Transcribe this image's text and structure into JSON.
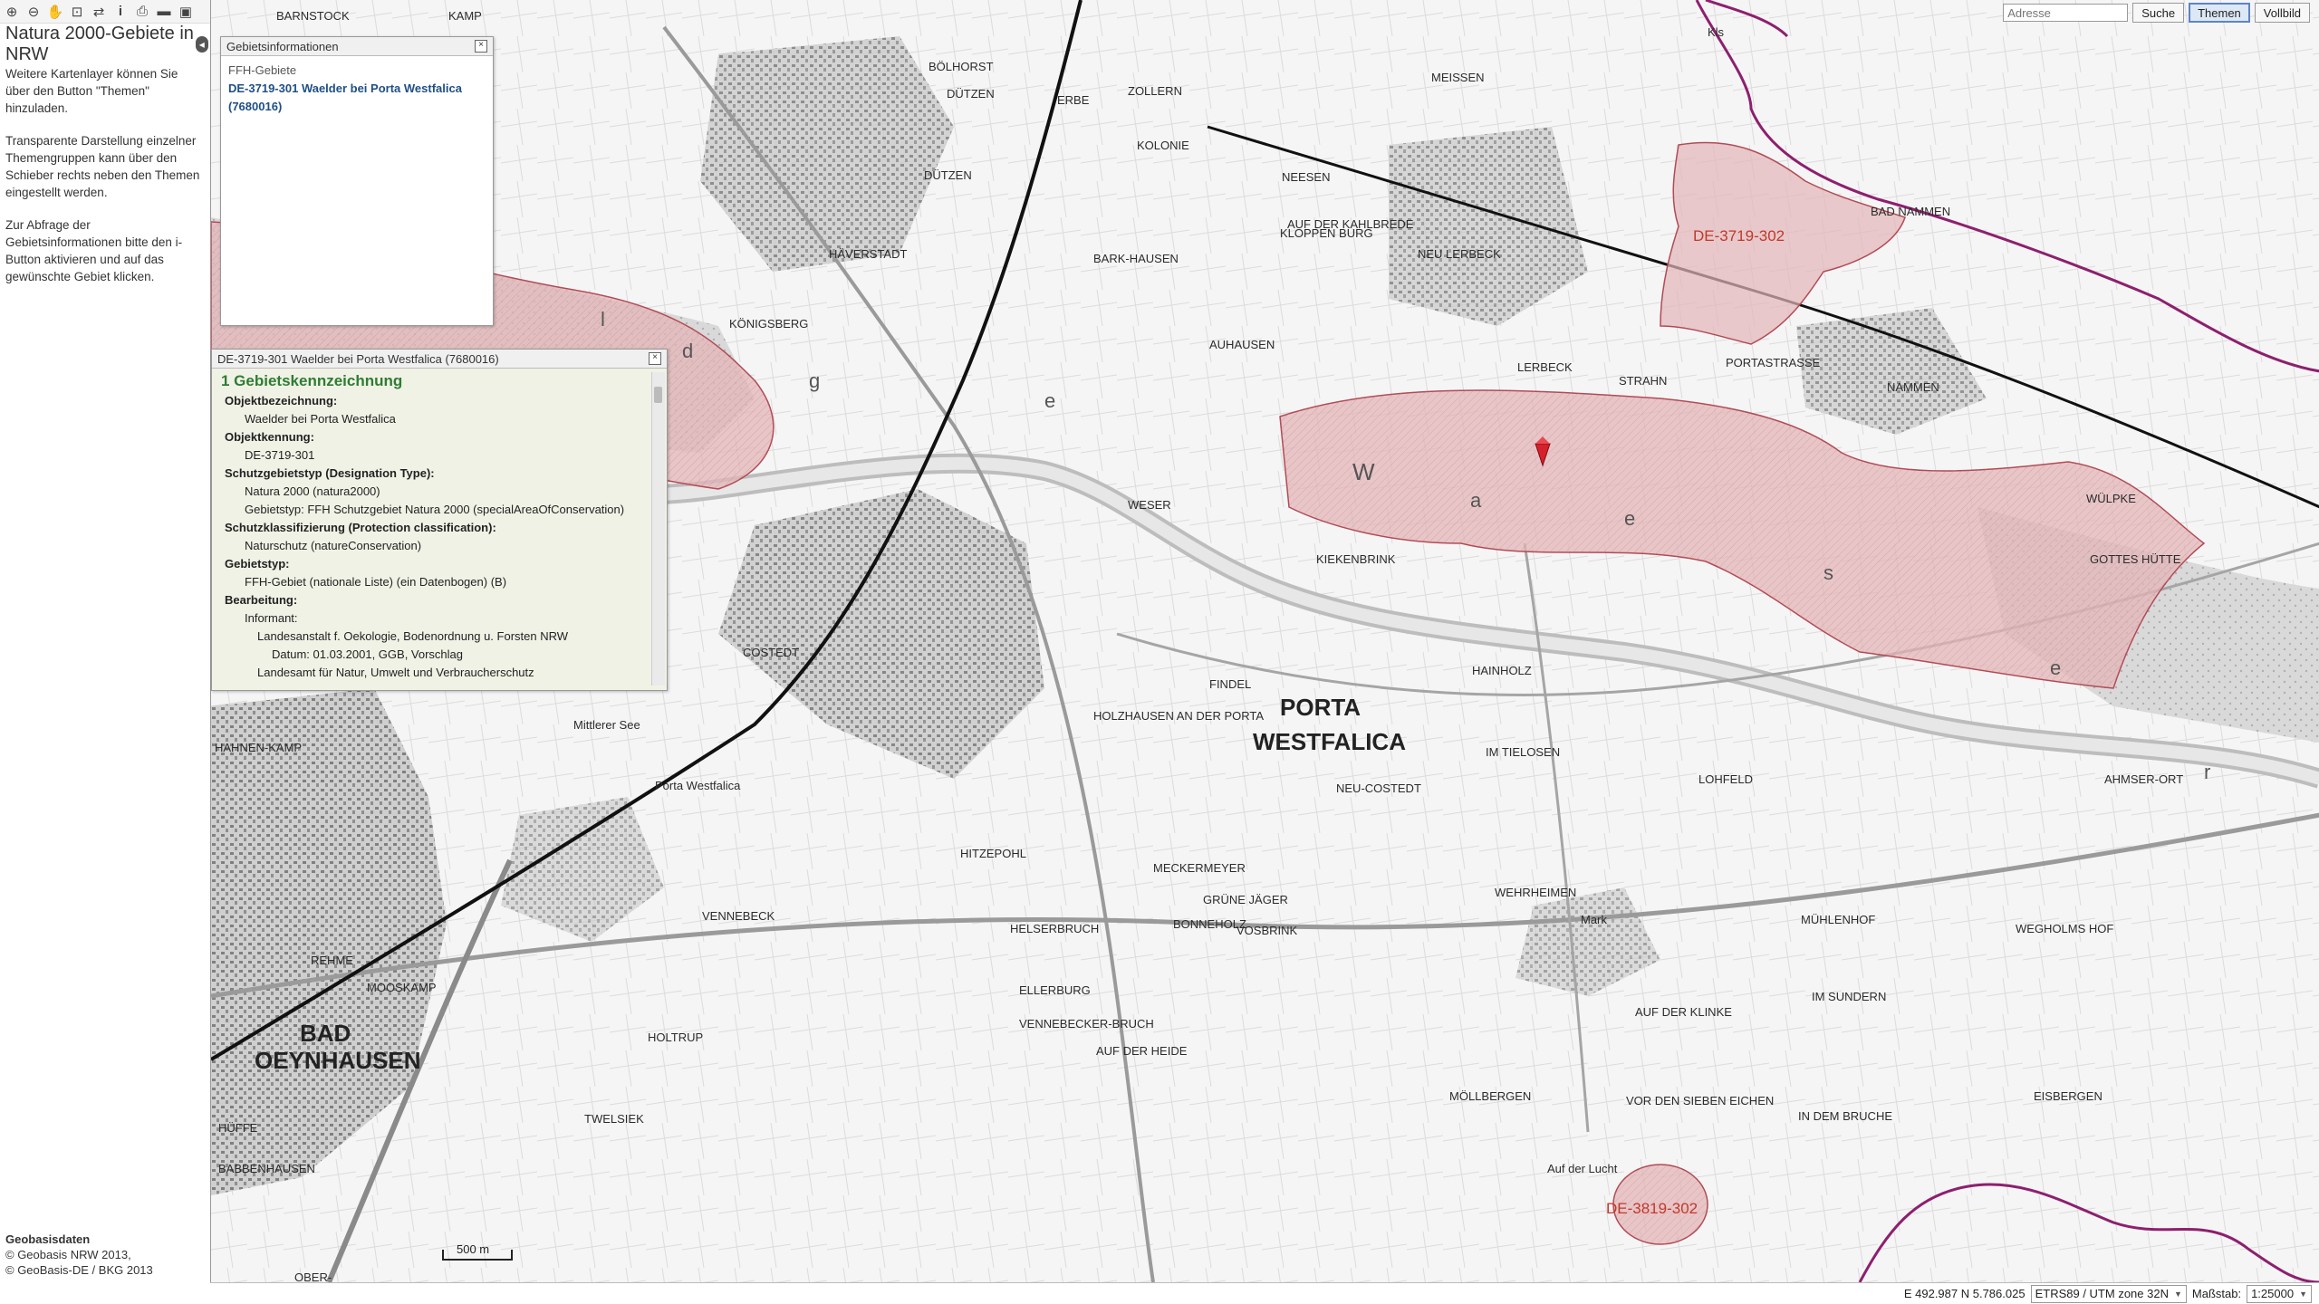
{
  "toolbar": {
    "icons": [
      "zoom-in-icon",
      "zoom-out-icon",
      "pan-icon",
      "zoom-box-icon",
      "back-icon",
      "info-icon",
      "print-icon",
      "measure-icon",
      "fullextent-icon"
    ]
  },
  "sidebar": {
    "title": "Natura 2000-Gebiete in NRW",
    "paragraphs": [
      "Weitere Kartenlayer können Sie über den Button \"Themen\" hinzuladen.",
      "Transparente Darstellung einzelner Themengruppen kann über den Schieber rechts neben den Themen eingestellt werden.",
      "Zur Abfrage der Gebietsinformationen bitte den i-Button aktivieren und auf das gewünschte Gebiet klicken."
    ],
    "footer": {
      "heading": "Geobasisdaten",
      "lines": [
        "© Geobasis NRW 2013,",
        "© GeoBasis-DE / BKG 2013"
      ]
    }
  },
  "topbar": {
    "address_placeholder": "Adresse",
    "search_label": "Suche",
    "themes_label": "Themen",
    "fullscreen_label": "Vollbild"
  },
  "info_panel": {
    "title": "Gebietsinformationen",
    "category": "FFH-Gebiete",
    "link_text": "DE-3719-301 Waelder bei Porta Westfalica (7680016)"
  },
  "detail_panel": {
    "title": "DE-3719-301 Waelder bei Porta Westfalica (7680016)",
    "section": "1 Gebietskennzeichnung",
    "fields": [
      {
        "label": "Objektbezeichnung:",
        "values": [
          "Waelder bei Porta Westfalica"
        ]
      },
      {
        "label": "Objektkennung:",
        "values": [
          "DE-3719-301"
        ]
      },
      {
        "label": "Schutzgebietstyp (Designation Type):",
        "values": [
          "Natura 2000 (natura2000)",
          "Gebietstyp: FFH Schutzgebiet Natura 2000 (specialAreaOfConservation)"
        ]
      },
      {
        "label": "Schutzklassifizierung (Protection classification):",
        "values": [
          "Naturschutz (natureConservation)"
        ]
      },
      {
        "label": "Gebietstyp:",
        "values": [
          "FFH-Gebiet (nationale Liste) (ein Datenbogen) (B)"
        ]
      },
      {
        "label": "Bearbeitung:",
        "values": []
      }
    ],
    "bearbeitung": {
      "informant_label": "Informant:",
      "line1": "Landesanstalt f. Oekologie, Bodenordnung u. Forsten NRW",
      "line2": "Datum: 01.03.2001, GGB, Vorschlag",
      "line3": "Landesamt für Natur, Umwelt und Verbraucherschutz"
    }
  },
  "map": {
    "labels": {
      "ffh_area_a": "DE-3719-302",
      "ffh_area_b": "DE-3819-302",
      "city_porta_1": "PORTA",
      "city_porta_2": "WESTFALICA",
      "city_bad_1": "BAD",
      "city_bad_2": "OEYNHAUSEN",
      "forest_w": "W",
      "forest_a": "a",
      "forest_l": "l",
      "forest_d": "d",
      "forest_e": "e",
      "forest_r": "r",
      "forest_g": "g",
      "forest_e2": "e",
      "forest_s": "s",
      "forest_e3": "e",
      "place_list": [
        "BARNSTOCK",
        "KAMP",
        "BÖLHORST",
        "DÜTZEN",
        "ERBE",
        "ZOLLERN",
        "KOLONIE",
        "HÄVERSTADT",
        "BARK-HAUSEN",
        "KÖNIGSBERG",
        "AUHAUSEN",
        "NEESEN",
        "KLOPPEN BURG",
        "AUF DER KAHLBREDE",
        "NEU LERBECK",
        "MEISSEN",
        "LERBECK",
        "STRAHN",
        "NAMMEN",
        "BAD NAMMEN",
        "PORTASTRASSE",
        "COSTEDT",
        "KIEKENBRINK",
        "HAINHOLZ",
        "LOHFELD",
        "IM TIELOSEN",
        "NEU-COSTEDT",
        "FINDEL",
        "HOLZHAUSEN AN DER PORTA",
        "HAHNEN-KAMP",
        "REHME",
        "MOOSKAMP",
        "HITZEPOHL",
        "VENNEBECK",
        "HELSERBRUCH",
        "BONNEHOLZ",
        "VOSBRINK",
        "ELLERBURG",
        "VENNEBECKER-BRUCH",
        "AUF DER HEIDE",
        "HOLTRUP",
        "MÖLLBERGEN",
        "AUF DER KLINKE",
        "VOR DEN SIEBEN EICHEN",
        "IN DEM BRUCHE",
        "EISBERGEN",
        "IM SUNDERN",
        "AHMSER-ORT",
        "WÜLPKE",
        "GOTTES HÜTTE",
        "BABBENHAUSEN",
        "OBER-",
        "HÜFFE",
        "WEHRHEIMEN",
        "MÜHLENHOF",
        "WEGHOLMS HOF",
        "Mark",
        "GRÜNE JÄGER",
        "MECKERMEYER",
        "Mittlerer See",
        "DÜTZEN",
        "TWELSIEK",
        "Porta Westfalica",
        "WESER",
        "Kls",
        "Auf der Lucht"
      ]
    },
    "scale_text": "500 m"
  },
  "statusbar": {
    "coords": "E 492.987 N 5.786.025",
    "crs": "ETRS89 / UTM zone 32N",
    "scale_label": "Maßstab:",
    "scale_value": "1:25000"
  },
  "colors": {
    "ffh_fill": "#e3b5b8",
    "ffh_stroke": "#b24a55",
    "boundary": "#8e1f6e",
    "rail": "#111111",
    "road": "#8a8a8a",
    "marker": "#d6202a",
    "panel_bg": "#f1f2e6",
    "section_green": "#2e7d32"
  }
}
